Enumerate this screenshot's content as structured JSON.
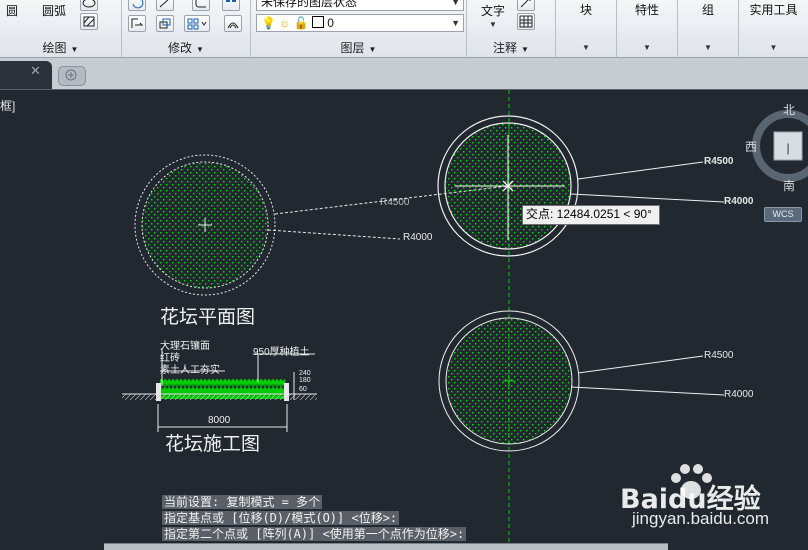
{
  "ribbon": {
    "draw_panel": {
      "title": "绘图",
      "items": [
        "圆",
        "圆弧"
      ]
    },
    "modify_panel": {
      "title": "修改"
    },
    "layer_panel": {
      "title": "图层",
      "layer_state": "未保存的图层状态",
      "current_layer": "0"
    },
    "annotation_panel": {
      "title": "注释",
      "text_label": "文字"
    },
    "big_tools": [
      "块",
      "特性",
      "组",
      "实用工具"
    ]
  },
  "viewport_label": "框]",
  "viewcube": {
    "north": "北",
    "west": "西",
    "south": "南",
    "wcs": "WCS"
  },
  "drawing": {
    "plan_title": "花坛平面图",
    "construction_title": "花坛施工图",
    "left_dims": {
      "r_outer": "R4500",
      "r_inner": "R4000"
    },
    "right_top_dims": {
      "r_outer": "R4500",
      "r_inner": "R4000"
    },
    "right_bottom_dims": {
      "r_outer": "R4500",
      "r_inner": "R4000"
    },
    "section_notes": [
      "大理石镶面",
      "红砖",
      "素土人工夯实"
    ],
    "soil_note": "950厚种植土",
    "section_dims": [
      "240",
      "180",
      "60"
    ],
    "width_dim": "8000"
  },
  "tooltip": "交点: 12484.0251 < 90°",
  "command_lines": [
    "当前设置:  复制模式 = 多个",
    "指定基点或 [位移(D)/模式(O)] <位移>:",
    "指定第二个点或 [阵列(A)] <使用第一个点作为位移>:"
  ],
  "watermark": {
    "brand": "Baidu经验",
    "url": "jingyan.baidu.com"
  },
  "colors": {
    "canvas": "#212830",
    "hatch": "#00e000",
    "ribbon": "#e6eaee"
  }
}
